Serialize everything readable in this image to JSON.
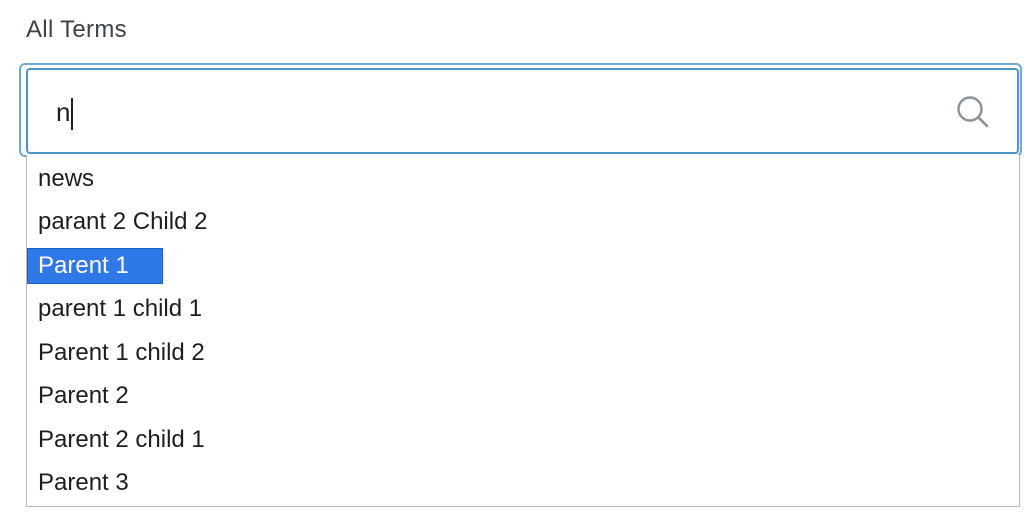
{
  "field": {
    "label": "All Terms"
  },
  "search": {
    "value": "n",
    "icon": "search-icon"
  },
  "dropdown": {
    "options": [
      "news",
      "parant 2 Child 2",
      "Parent 1",
      "parent 1 child 1",
      "Parent 1 child 2",
      "Parent 2",
      "Parent 2 child 1",
      "Parent 3"
    ],
    "highlighted": "Parent 1"
  },
  "colors": {
    "focus_border": "#4f94c9",
    "highlight": "#2f78e8"
  }
}
